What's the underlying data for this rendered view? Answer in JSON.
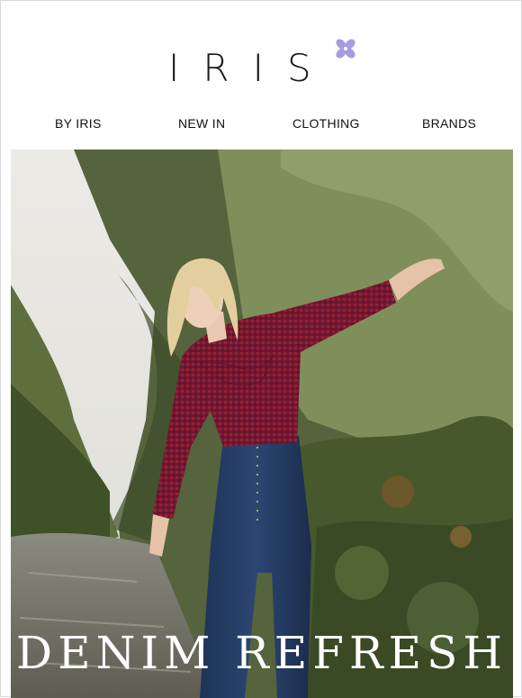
{
  "brand": {
    "name": "IRIS",
    "logo_icon": "flower-icon",
    "accent_color": "#a99be0"
  },
  "nav": {
    "items": [
      {
        "label": "BY IRIS"
      },
      {
        "label": "NEW IN"
      },
      {
        "label": "CLOTHING"
      },
      {
        "label": "BRANDS"
      }
    ]
  },
  "hero": {
    "image": "model-in-red-gingham-blouse-and-denim-by-stream-photo",
    "headline": "DENIM REFRESH"
  }
}
